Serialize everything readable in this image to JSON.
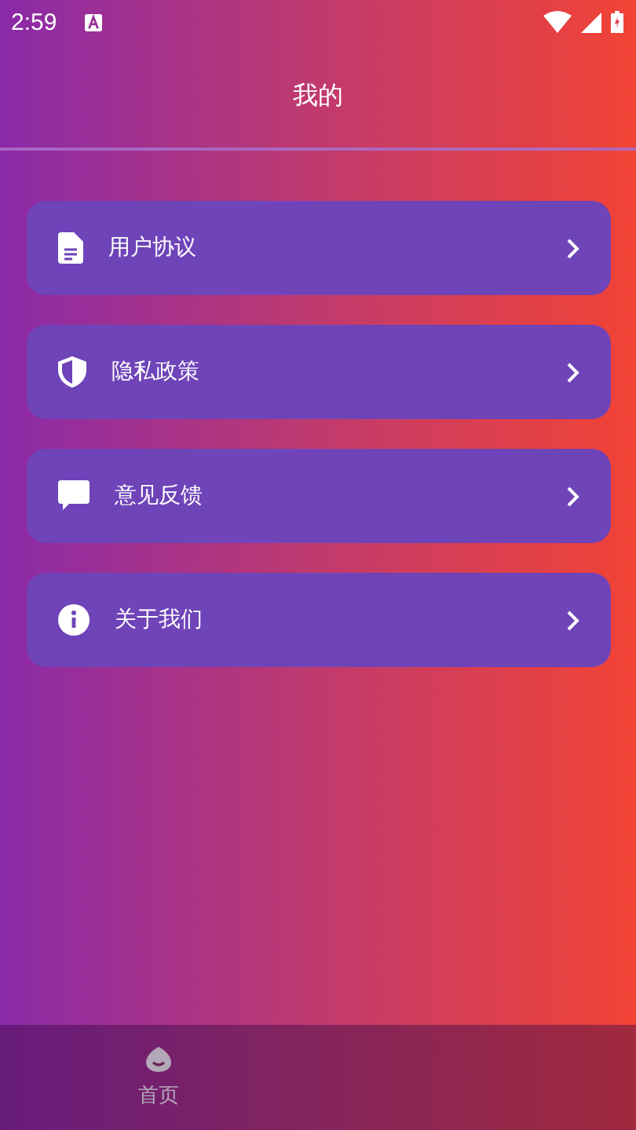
{
  "status_bar": {
    "time": "2:59"
  },
  "header": {
    "title": "我的"
  },
  "menu": [
    {
      "label": "用户协议",
      "kind": "document"
    },
    {
      "label": "隐私政策",
      "kind": "shield"
    },
    {
      "label": "意见反馈",
      "kind": "chat"
    },
    {
      "label": "关于我们",
      "kind": "info"
    }
  ],
  "bottom_nav": [
    {
      "label": "首页",
      "kind": "home"
    }
  ]
}
